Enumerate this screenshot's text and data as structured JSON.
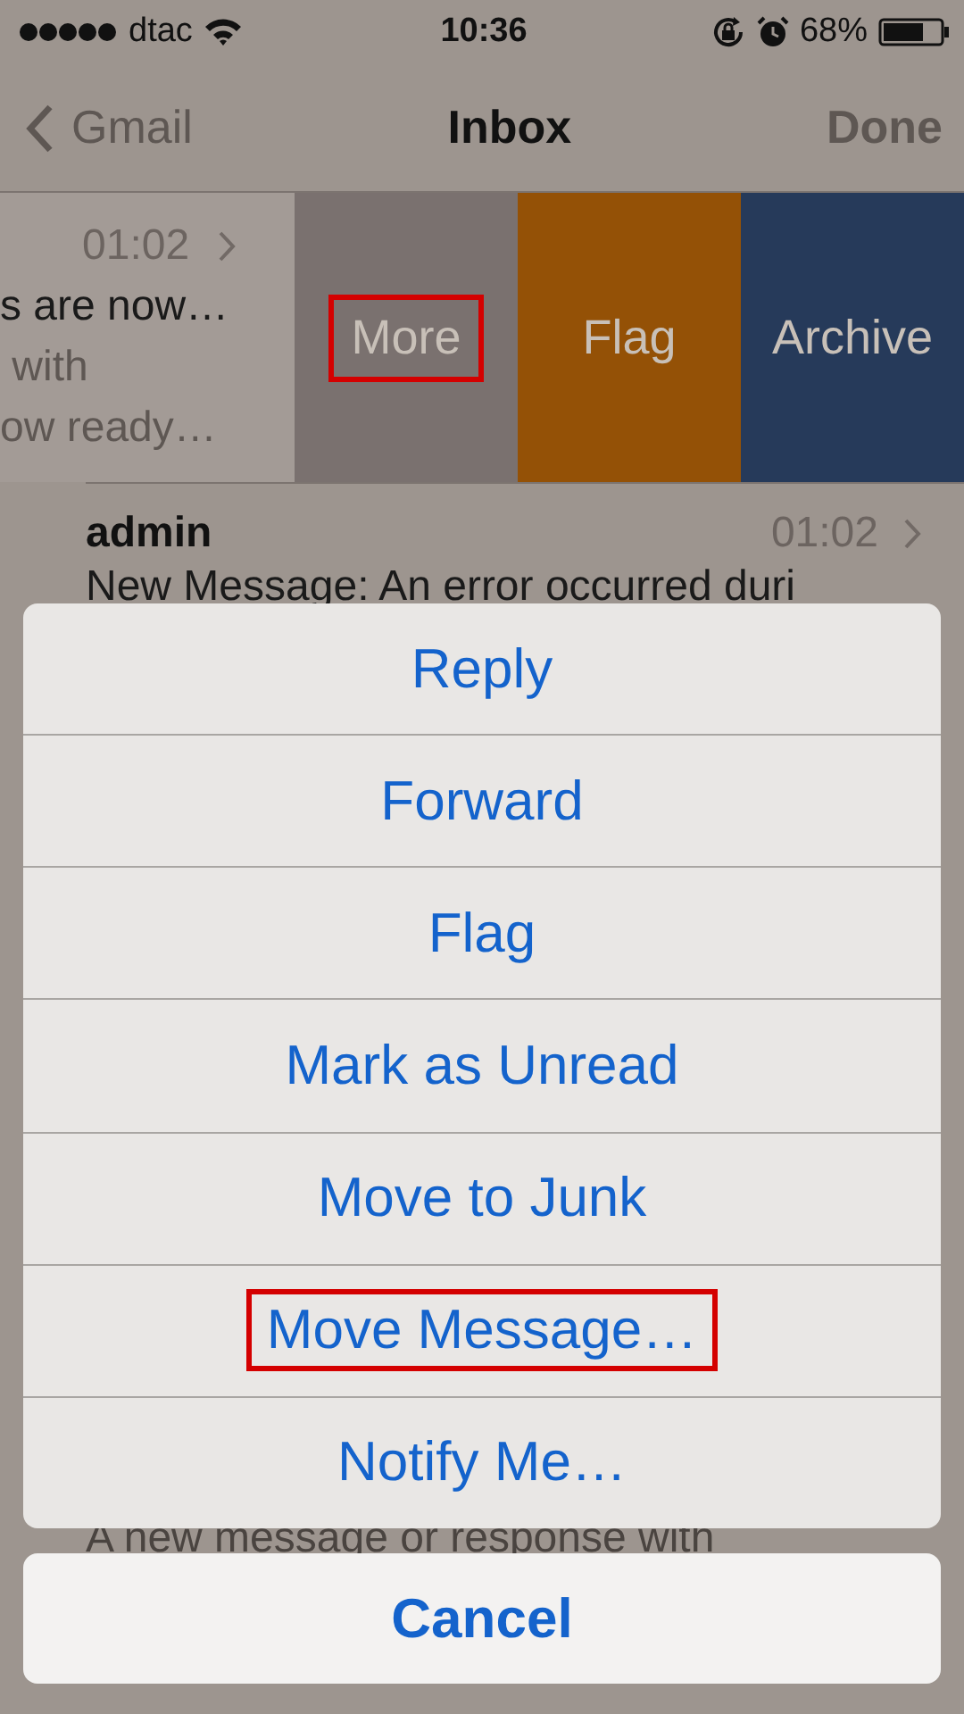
{
  "status_bar": {
    "carrier": "dtac",
    "time": "10:36",
    "battery": "68%"
  },
  "nav_bar": {
    "back": "Gmail",
    "title": "Inbox",
    "action": "Done"
  },
  "swiped_row": {
    "time": "01:02",
    "lines": [
      "s are now…",
      " with",
      "ow ready…"
    ],
    "actions": [
      {
        "label": "More",
        "kind": "more",
        "highlighted": true
      },
      {
        "label": "Flag",
        "kind": "flag",
        "highlighted": false
      },
      {
        "label": "Archive",
        "kind": "archive",
        "highlighted": false
      }
    ]
  },
  "message_row": {
    "sender": "admin",
    "time": "01:02",
    "preview": "New Message: An error occurred duri"
  },
  "hidden_preview": "A new message or response with",
  "action_sheet": {
    "items": [
      {
        "label": "Reply",
        "highlighted": false
      },
      {
        "label": "Forward",
        "highlighted": false
      },
      {
        "label": "Flag",
        "highlighted": false
      },
      {
        "label": "Mark as Unread",
        "highlighted": false
      },
      {
        "label": "Move to Junk",
        "highlighted": false
      },
      {
        "label": "Move Message…",
        "highlighted": true
      },
      {
        "label": "Notify Me…",
        "highlighted": false
      }
    ],
    "cancel": "Cancel"
  }
}
